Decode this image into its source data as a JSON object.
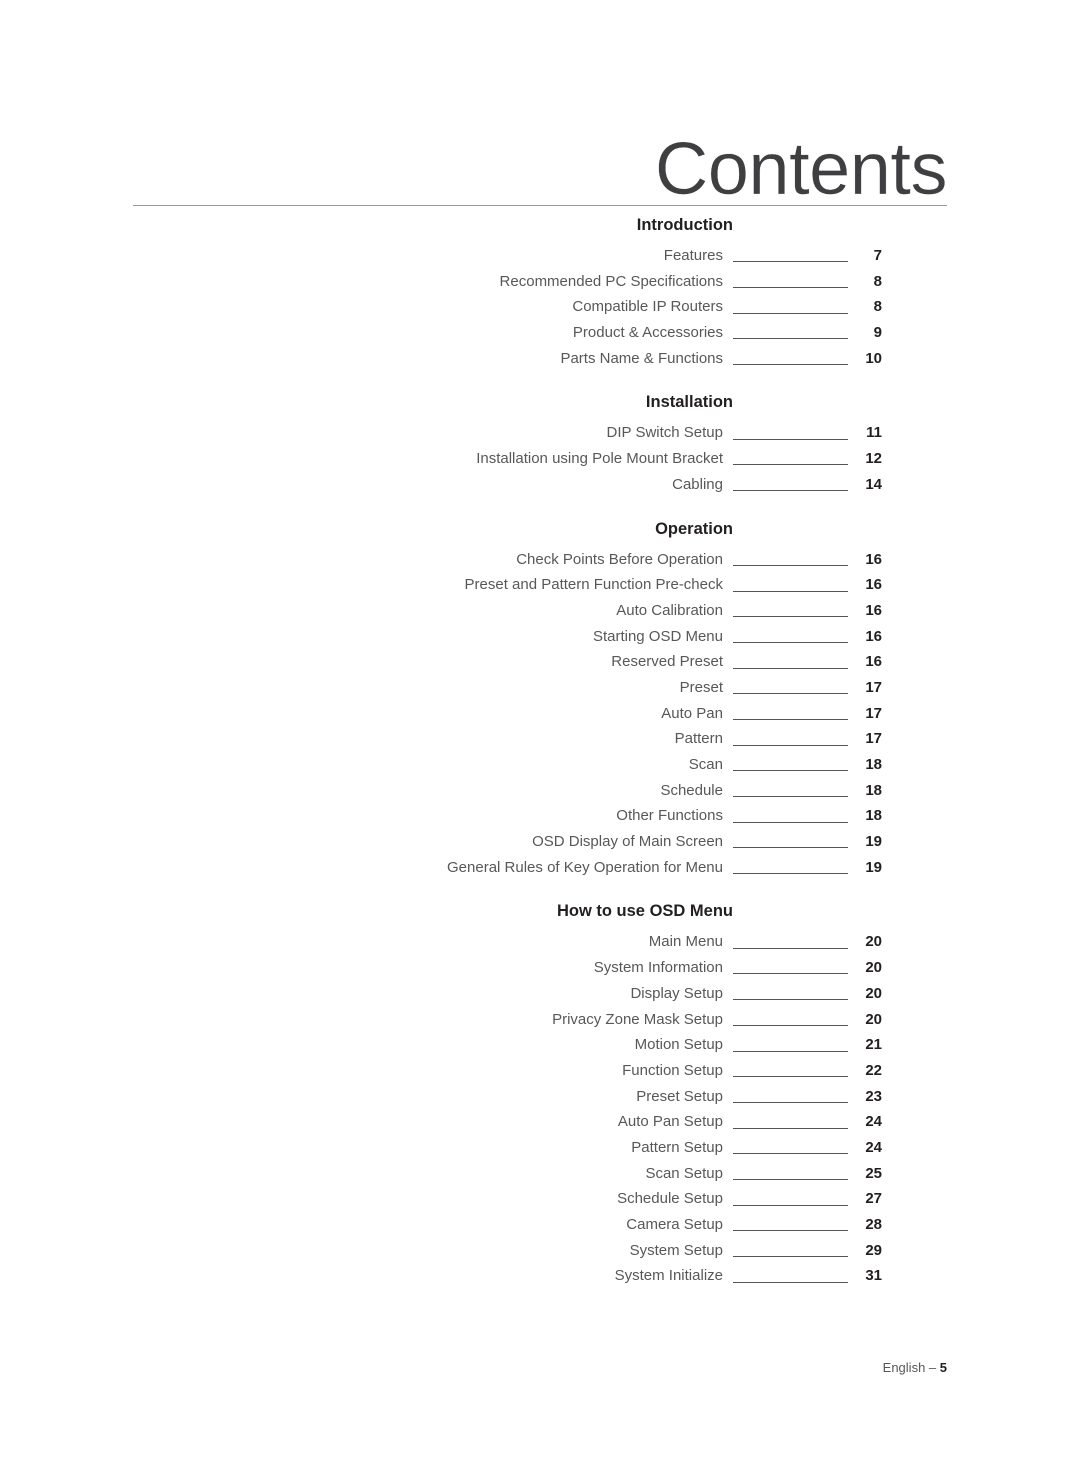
{
  "document": {
    "title": "Contents",
    "footer": {
      "language": "English –",
      "page_number": "5"
    }
  },
  "toc": {
    "sections": [
      {
        "header": "Introduction",
        "entries": [
          {
            "title": "Features",
            "page": "7"
          },
          {
            "title": "Recommended PC Specifications",
            "page": "8"
          },
          {
            "title": "Compatible IP Routers",
            "page": "8"
          },
          {
            "title": "Product & Accessories",
            "page": "9"
          },
          {
            "title": "Parts Name & Functions",
            "page": "10"
          }
        ]
      },
      {
        "header": "Installation",
        "entries": [
          {
            "title": "DIP Switch Setup",
            "page": "11"
          },
          {
            "title": "Installation using Pole Mount Bracket",
            "page": "12"
          },
          {
            "title": "Cabling",
            "page": "14"
          }
        ]
      },
      {
        "header": "Operation",
        "entries": [
          {
            "title": "Check Points Before Operation",
            "page": "16"
          },
          {
            "title": "Preset and Pattern Function Pre-check",
            "page": "16"
          },
          {
            "title": "Auto Calibration",
            "page": "16"
          },
          {
            "title": "Starting OSD Menu",
            "page": "16"
          },
          {
            "title": "Reserved Preset",
            "page": "16"
          },
          {
            "title": "Preset",
            "page": "17"
          },
          {
            "title": "Auto Pan",
            "page": "17"
          },
          {
            "title": "Pattern",
            "page": "17"
          },
          {
            "title": "Scan",
            "page": "18"
          },
          {
            "title": "Schedule",
            "page": "18"
          },
          {
            "title": "Other Functions",
            "page": "18"
          },
          {
            "title": "OSD Display of Main Screen",
            "page": "19"
          },
          {
            "title": "General Rules of Key Operation for Menu",
            "page": "19"
          }
        ]
      },
      {
        "header": "How to use OSD Menu",
        "entries": [
          {
            "title": "Main Menu",
            "page": "20"
          },
          {
            "title": "System Information",
            "page": "20"
          },
          {
            "title": "Display Setup",
            "page": "20"
          },
          {
            "title": "Privacy Zone Mask Setup",
            "page": "20"
          },
          {
            "title": "Motion Setup",
            "page": "21"
          },
          {
            "title": "Function Setup",
            "page": "22"
          },
          {
            "title": "Preset Setup",
            "page": "23"
          },
          {
            "title": "Auto Pan Setup",
            "page": "24"
          },
          {
            "title": "Pattern Setup",
            "page": "24"
          },
          {
            "title": "Scan Setup",
            "page": "25"
          },
          {
            "title": "Schedule Setup",
            "page": "27"
          },
          {
            "title": "Camera Setup",
            "page": "28"
          },
          {
            "title": "System Setup",
            "page": "29"
          },
          {
            "title": "System Initialize",
            "page": "31"
          }
        ]
      }
    ]
  },
  "colors": {
    "title_text": "#3f3f41",
    "header_text": "#231f20",
    "entry_text": "#58585a",
    "leader_line": "#56565a",
    "rule_line": "#9a9a9c",
    "page_background": "#ffffff"
  }
}
